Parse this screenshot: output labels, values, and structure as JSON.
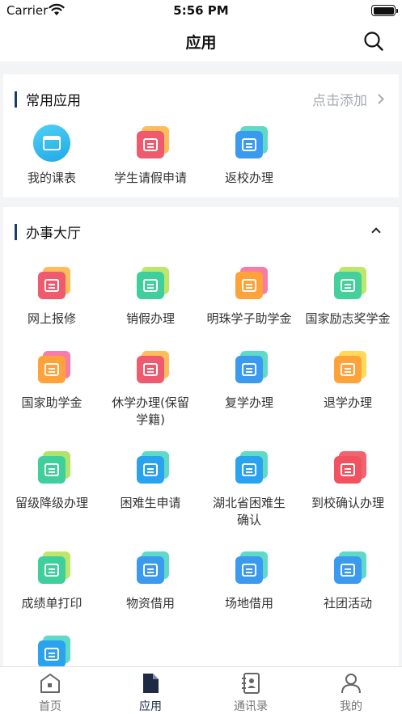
{
  "status": {
    "carrier": "Carrier",
    "time": "5:56 PM"
  },
  "nav": {
    "title": "应用"
  },
  "common": {
    "title": "常用应用",
    "action": "点击添加",
    "apps": [
      {
        "label": "我的课表",
        "icon": "calendar-icon"
      },
      {
        "label": "学生请假申请",
        "icon": "leave-request-icon"
      },
      {
        "label": "返校办理",
        "icon": "return-school-icon"
      }
    ]
  },
  "hall": {
    "title": "办事大厅",
    "apps": [
      {
        "label": "网上报修",
        "icon": "repair-icon",
        "color": "#f05a6e",
        "back": "#ffb648"
      },
      {
        "label": "销假办理",
        "icon": "leave-cancel-icon",
        "color": "#3fcf9d",
        "back": "#b6e35a"
      },
      {
        "label": "明珠学子助学金",
        "icon": "money-bag-icon",
        "color": "#ffa23a",
        "back": "#f56ea0"
      },
      {
        "label": "国家励志奖学金",
        "icon": "money-bag-icon",
        "color": "#43d09a",
        "back": "#b6e35a"
      },
      {
        "label": "国家助学金",
        "icon": "money-bag-icon",
        "color": "#ffa23a",
        "back": "#f56ea0"
      },
      {
        "label": "休学办理(保留学籍)",
        "icon": "suspend-icon",
        "color": "#f05a6e",
        "back": "#ffb648"
      },
      {
        "label": "复学办理",
        "icon": "resume-icon",
        "color": "#3a9af0",
        "back": "#4dd6c0"
      },
      {
        "label": "退学办理",
        "icon": "withdraw-icon",
        "color": "#ffa23a",
        "back": "#ffd548"
      },
      {
        "label": "留级降级办理",
        "icon": "repeat-grade-icon",
        "color": "#3fcf9d",
        "back": "#a8e05a"
      },
      {
        "label": "困难生申请",
        "icon": "hardship-icon",
        "color": "#2aa3ee",
        "back": "#4dd6c0"
      },
      {
        "label": "湖北省困难生确认",
        "icon": "hardship-confirm-icon",
        "color": "#2aa3ee",
        "back": "#4dd6c0"
      },
      {
        "label": "到校确认办理",
        "icon": "arrival-confirm-icon",
        "color": "#f0535f",
        "back": "#f0535f"
      },
      {
        "label": "成绩单打印",
        "icon": "transcript-icon",
        "color": "#3fcf9d",
        "back": "#b6e35a"
      },
      {
        "label": "物资借用",
        "icon": "clipboard-icon",
        "color": "#3a9af0",
        "back": "#4dd6c0"
      },
      {
        "label": "场地借用",
        "icon": "venue-icon",
        "color": "#3a9af0",
        "back": "#4dd6c0"
      },
      {
        "label": "社团活动",
        "icon": "club-icon",
        "color": "#3a9af0",
        "back": "#4dd6c0"
      },
      {
        "label": "",
        "icon": "user-card-icon",
        "color": "#2aa3ee",
        "back": "#4dd6c0"
      }
    ]
  },
  "tabs": [
    {
      "label": "首页",
      "icon": "home-icon"
    },
    {
      "label": "应用",
      "icon": "document-icon",
      "active": true
    },
    {
      "label": "通讯录",
      "icon": "contacts-icon"
    },
    {
      "label": "我的",
      "icon": "person-icon"
    }
  ]
}
